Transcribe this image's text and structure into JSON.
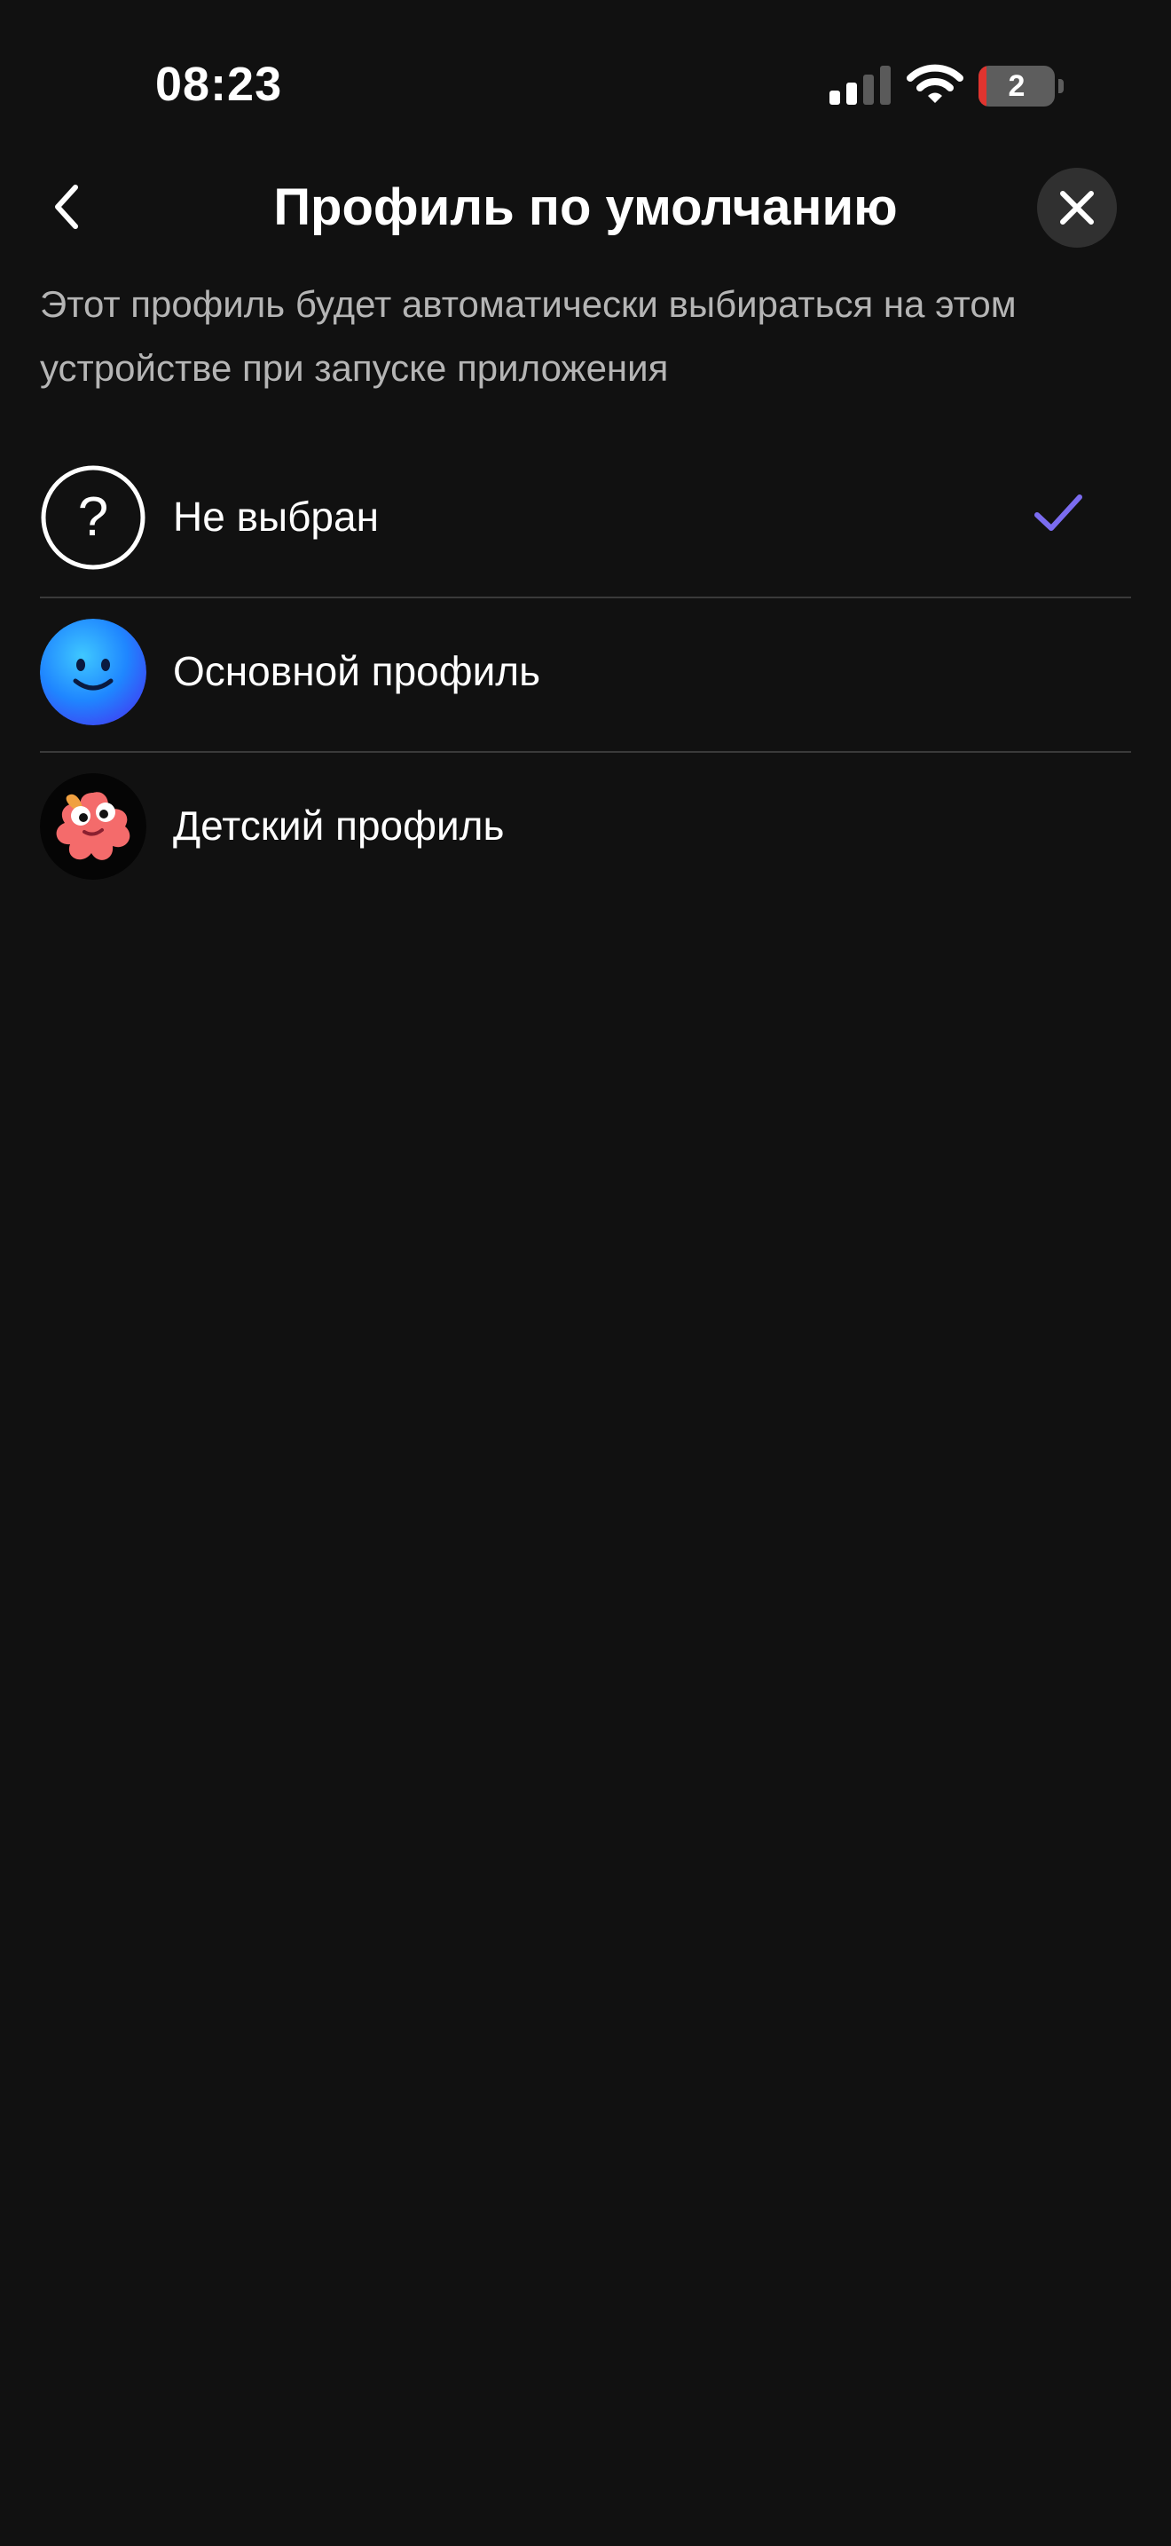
{
  "status_bar": {
    "time": "08:23",
    "battery_level": "2",
    "battery_fraction": 0.1,
    "icons": [
      "signal-icon",
      "wifi-icon",
      "battery-icon"
    ]
  },
  "header": {
    "title": "Профиль по умолчанию",
    "back_icon": "chevron-left-icon",
    "close_icon": "close-icon"
  },
  "description": "Этот профиль будет автоматически выбираться на этом устройстве при запуске приложения",
  "profiles": [
    {
      "label": "Не выбран",
      "avatar": "question-mark-icon",
      "selected": true
    },
    {
      "label": "Основной профиль",
      "avatar": "smiley-avatar",
      "selected": false
    },
    {
      "label": "Детский профиль",
      "avatar": "kids-character-avatar",
      "selected": false
    }
  ],
  "colors": {
    "background": "#111111",
    "accent_check": "#7b6cf0",
    "avatar_blue": "#2a7bff",
    "battery_low": "#e0342f"
  }
}
